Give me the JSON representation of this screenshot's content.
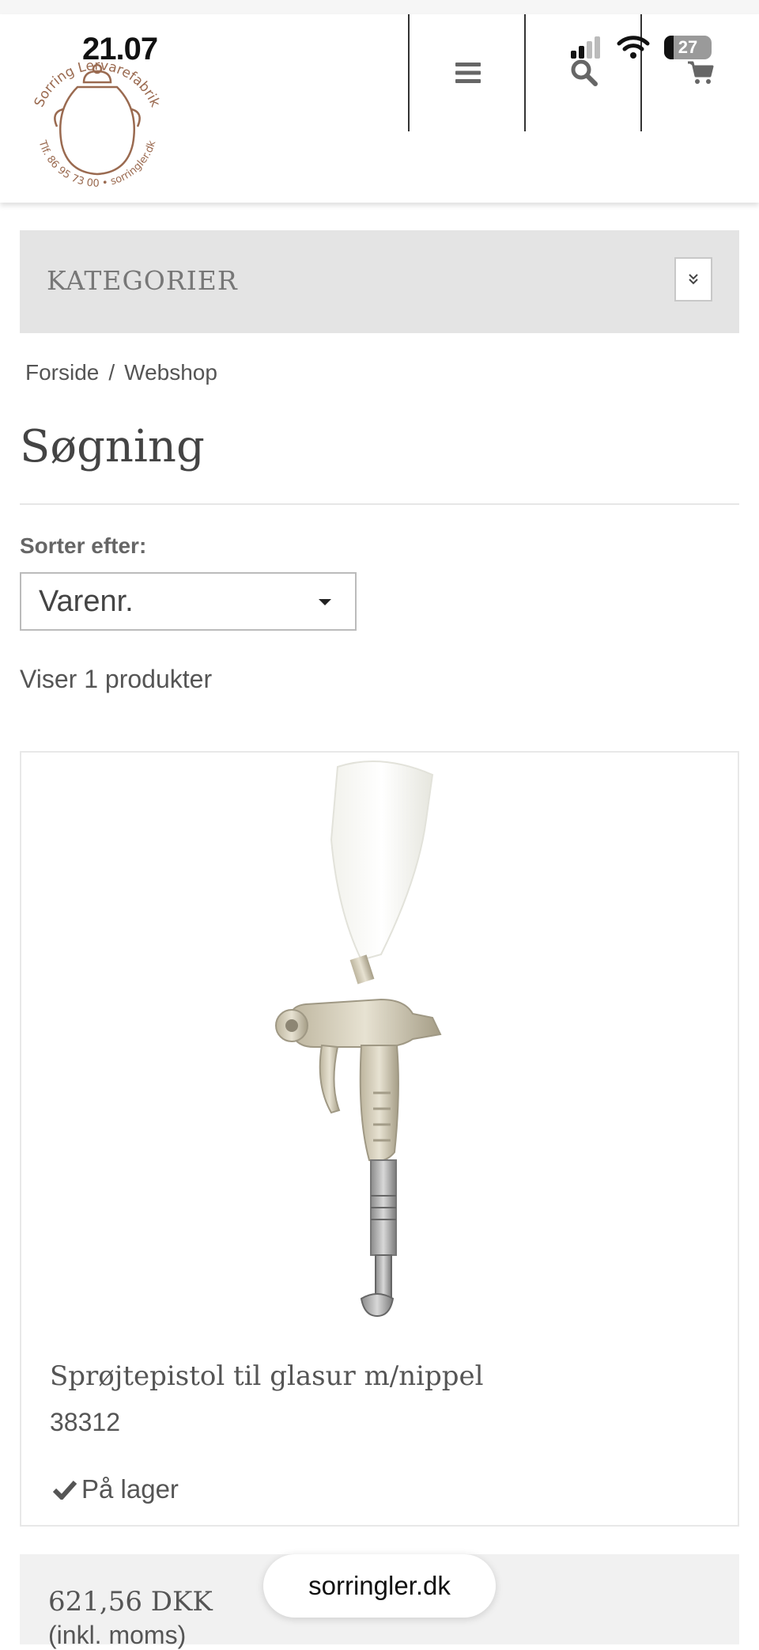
{
  "status_bar": {
    "time": "21.07",
    "battery": "27"
  },
  "brand": {
    "logo_top": "Sorring Lervarefabrik",
    "logo_bottom": "Tlf. 86 95 73 00 • sorringler.dk"
  },
  "categories": {
    "label": "KATEGORIER"
  },
  "breadcrumb": {
    "home": "Forside",
    "separator": "/",
    "current": "Webshop"
  },
  "page": {
    "title": "Søgning"
  },
  "sort": {
    "label": "Sorter efter:",
    "selected": "Varenr."
  },
  "results": {
    "count_text": "Viser 1 produkter"
  },
  "product": {
    "name": "Sprøjtepistol til glasur m/nippel",
    "sku": "38312",
    "stock": "På lager",
    "price": "621,56 DKK",
    "price_note": "(inkl. moms)"
  },
  "browser": {
    "url": "sorringler.dk"
  },
  "colors": {
    "accent": "#9a6a50",
    "panel": "#e4e4e4"
  }
}
